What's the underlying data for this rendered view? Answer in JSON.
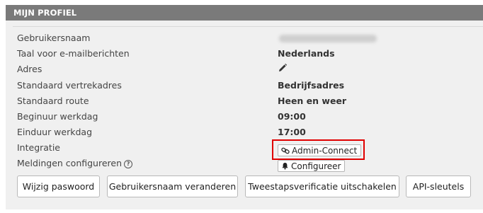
{
  "panel": {
    "title": "MIJN PROFIEL"
  },
  "rows": [
    {
      "label": "Gebruikersnaam",
      "value": ""
    },
    {
      "label": "Taal voor e-mailberichten",
      "value": "Nederlands"
    },
    {
      "label": "Adres",
      "value": ""
    },
    {
      "label": "Standaard vertrekadres",
      "value": "Bedrijfsadres"
    },
    {
      "label": "Standaard route",
      "value": "Heen en weer"
    },
    {
      "label": "Beginuur werkdag",
      "value": "09:00"
    },
    {
      "label": "Einduur werkdag",
      "value": "17:00"
    },
    {
      "label": "Integratie",
      "value": ""
    },
    {
      "label": "Meldingen configureren",
      "value": ""
    }
  ],
  "icons": {
    "address_edit": "pencil-icon",
    "help": "question-circle-icon",
    "integration": "link-icon",
    "notifications": "bell-icon"
  },
  "integration": {
    "button_label": "Admin-Connect"
  },
  "notifications": {
    "button_label": "Configureer"
  },
  "actions": {
    "change_password": "Wijzig paswoord",
    "change_username": "Gebruikersnaam veranderen",
    "disable_2fa": "Tweestapsverificatie uitschakelen",
    "api_keys": "API-sleutels"
  },
  "colors": {
    "header_bg": "#7a7a7a",
    "panel_bg": "#f0f0f0",
    "highlight_border": "#e00000"
  }
}
